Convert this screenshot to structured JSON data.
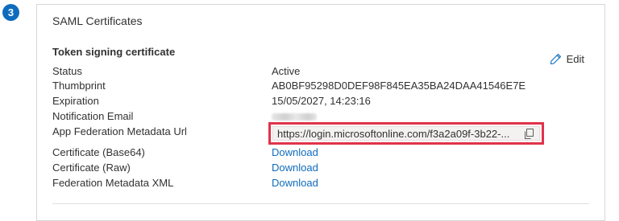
{
  "step": {
    "number": "3"
  },
  "panel": {
    "title": "SAML Certificates",
    "section_heading": "Token signing certificate",
    "edit_label": "Edit",
    "rows": {
      "status": {
        "label": "Status",
        "value": "Active"
      },
      "thumbprint": {
        "label": "Thumbprint",
        "value": "AB0BF95298D0DEF98F845EA35BA24DAA41546E7E"
      },
      "expiration": {
        "label": "Expiration",
        "value": "15/05/2027, 14:23:16"
      },
      "notification_email": {
        "label": "Notification Email"
      },
      "metadata_url": {
        "label": "App Federation Metadata Url",
        "value": "https://login.microsoftonline.com/f3a2a09f-3b22-..."
      },
      "cert_base64": {
        "label": "Certificate (Base64)",
        "link": "Download"
      },
      "cert_raw": {
        "label": "Certificate (Raw)",
        "link": "Download"
      },
      "federation_xml": {
        "label": "Federation Metadata XML",
        "link": "Download"
      }
    }
  },
  "colors": {
    "accent": "#0f6cbd",
    "highlight_border": "#e0334a",
    "text": "#323130"
  },
  "icons": {
    "edit": "pencil-icon",
    "copy": "copy-icon"
  }
}
